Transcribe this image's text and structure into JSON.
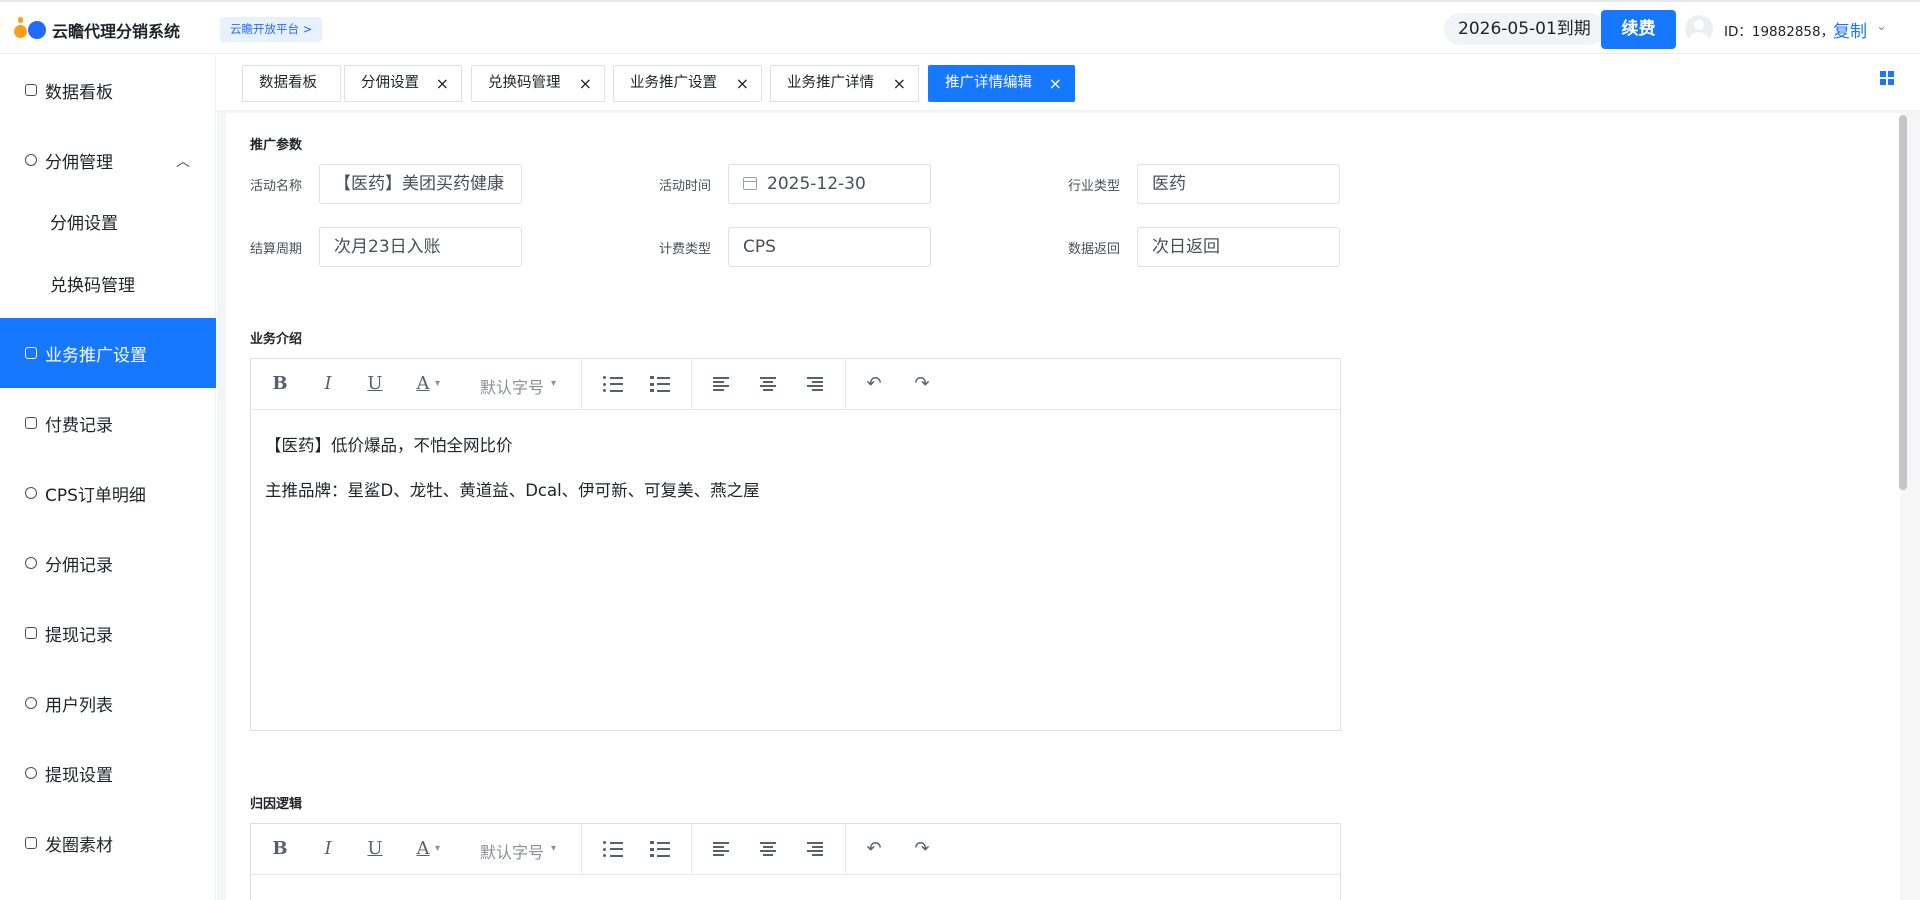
{
  "header": {
    "app_title": "云瞻代理分销系统",
    "platform_link": "云瞻开放平台 >",
    "expiry": "2026-05-01到期",
    "renew": "续费",
    "user_id": "ID：19882858，",
    "copy": "复制",
    "caret": "⌄"
  },
  "sidebar": {
    "items": [
      {
        "label": "数据看板",
        "icon": "monitor-icon"
      },
      {
        "label": "分佣管理",
        "icon": "user-icon",
        "arrow": "︿"
      },
      {
        "label": "业务推广设置",
        "icon": "briefcase-icon",
        "active": true
      },
      {
        "label": "付费记录",
        "icon": "record-icon"
      },
      {
        "label": "CPS订单明细",
        "icon": "order-icon"
      },
      {
        "label": "分佣记录",
        "icon": "target-icon"
      },
      {
        "label": "提现记录",
        "icon": "document-icon"
      },
      {
        "label": "用户列表",
        "icon": "users-icon"
      },
      {
        "label": "提现设置",
        "icon": "settings-icon"
      },
      {
        "label": "发圈素材",
        "icon": "material-icon"
      }
    ],
    "sub_items": [
      {
        "label": "分佣设置"
      },
      {
        "label": "兑换码管理"
      }
    ]
  },
  "tabs": [
    {
      "label": "数据看板",
      "closable": false
    },
    {
      "label": "分佣设置",
      "closable": true
    },
    {
      "label": "兑换码管理",
      "closable": true
    },
    {
      "label": "业务推广设置",
      "closable": true
    },
    {
      "label": "业务推广详情",
      "closable": true
    },
    {
      "label": "推广详情编辑",
      "closable": true,
      "active": true
    }
  ],
  "close_glyph": "×",
  "form": {
    "params_title": "推广参数",
    "fields": [
      {
        "label": "活动名称",
        "value": "【医药】美团买药健康"
      },
      {
        "label": "活动时间",
        "value": "2025-12-30"
      },
      {
        "label": "行业类型",
        "value": "医药"
      },
      {
        "label": "结算周期",
        "value": "次月23日入账"
      },
      {
        "label": "计费类型",
        "value": "CPS"
      },
      {
        "label": "数据返回",
        "value": "次日返回"
      }
    ]
  },
  "intro": {
    "title": "业务介绍",
    "lines": [
      "【医药】低价爆品，不怕全网比价",
      "主推品牌：星鲨D、龙牡、黄道益、Dcal、伊可新、可复美、燕之屋"
    ]
  },
  "attribution": {
    "title": "归因逻辑"
  },
  "toolbar": {
    "bold": "B",
    "italic": "I",
    "underline": "U",
    "font_color": "A",
    "font_color_caret": "▾",
    "font_size": "默认字号",
    "font_size_caret": "▾",
    "undo": "↶",
    "redo": "↷"
  },
  "colors": {
    "primary": "#1677ff",
    "logo_orange": "#ff9c1a"
  }
}
